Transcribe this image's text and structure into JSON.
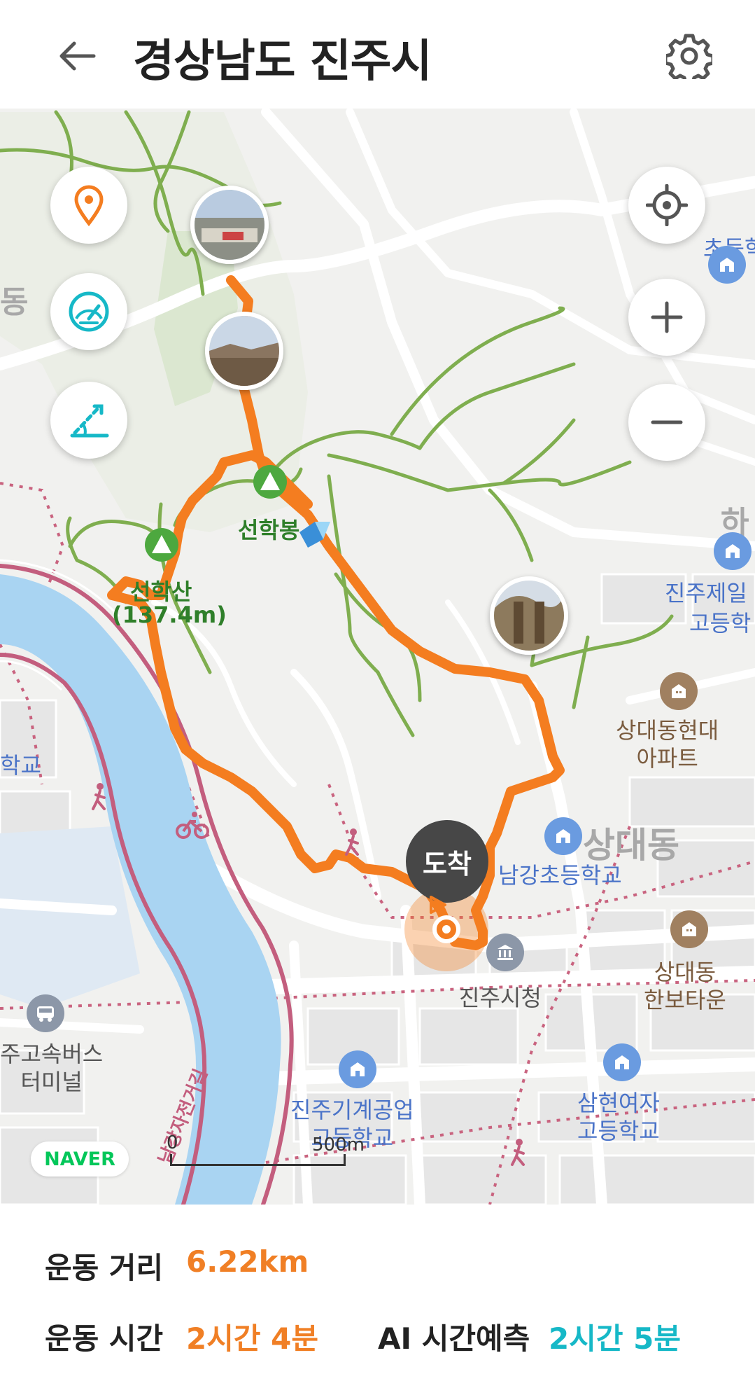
{
  "header": {
    "title": "경상남도 진주시",
    "back_icon": "arrow-left-icon",
    "settings_icon": "gear-icon"
  },
  "map": {
    "controls": {
      "left": [
        "location-pin-icon",
        "speedometer-icon",
        "slope-icon"
      ],
      "right": [
        "crosshair-icon",
        "zoom-in-icon",
        "zoom-out-icon"
      ]
    },
    "peaks": [
      {
        "name": "선학봉"
      },
      {
        "name": "선학산",
        "elevation": "(137.4m)"
      }
    ],
    "arrival_badge": "도착",
    "labels": {
      "chodeung": "초등학",
      "ha": "하",
      "dong_left": "동",
      "jinju_jeil": "진주제일",
      "godeung": "고등학",
      "sangdae_hyundai": "상대동현대\n아파트",
      "hakgyo_left": "학교",
      "sangdae_dong": "상대동",
      "namgang_elementary": "남강초등학교",
      "jinju_cityhall": "진주시청",
      "sangdae_hanbo": "상대동\n한보타운",
      "bus_terminal": "주고속버스\n터미널",
      "bike_road": "남강자전거길",
      "mechanical_school": "진주기계공업\n고등학교",
      "samhyeon_school": "삼현여자\n고등학교"
    },
    "attribution": "NAVER",
    "scale": {
      "start": "0",
      "end": "500m"
    },
    "colors": {
      "route": "#f47d20",
      "trail": "#7fae4f",
      "river": "#a9d4f2",
      "riverbank": "#c35e7e",
      "poi_blue": "#6a9be0",
      "poi_brown": "#a08060"
    }
  },
  "stats": {
    "distance_label": "운동 거리",
    "distance_value": "6.22km",
    "time_label": "운동 시간",
    "time_value": "2시간 4분",
    "ai_label": "AI 시간예측",
    "ai_value": "2시간 5분"
  }
}
